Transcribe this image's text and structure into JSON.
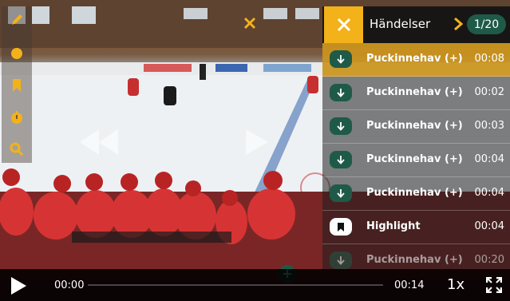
{
  "panel": {
    "title": "Händelser",
    "counter": "1/20",
    "events": [
      {
        "label": "Puckinnehav (+)",
        "time": "00:08",
        "icon": "arrow-down-icon",
        "active": true
      },
      {
        "label": "Puckinnehav (+)",
        "time": "00:02",
        "icon": "arrow-down-icon",
        "active": false
      },
      {
        "label": "Puckinnehav (+)",
        "time": "00:03",
        "icon": "arrow-down-icon",
        "active": false
      },
      {
        "label": "Puckinnehav (+)",
        "time": "00:04",
        "icon": "arrow-down-icon",
        "active": false
      },
      {
        "label": "Puckinnehav (+)",
        "time": "00:04",
        "icon": "arrow-down-icon",
        "active": false
      },
      {
        "label": "Highlight",
        "time": "00:04",
        "icon": "bookmark-icon",
        "active": false
      },
      {
        "label": "Puckinnehav (+)",
        "time": "00:20",
        "icon": "arrow-down-icon",
        "active": false
      }
    ]
  },
  "player": {
    "current_time": "00:00",
    "total_time": "00:14",
    "speed": "1x",
    "progress": 0
  },
  "tools": [
    "pencil-icon",
    "circle-icon",
    "bookmark-icon",
    "timer-icon",
    "search-icon"
  ],
  "colors": {
    "accent": "#f3b21a",
    "badge": "#1f5a48",
    "active_row": "#dca01e"
  }
}
